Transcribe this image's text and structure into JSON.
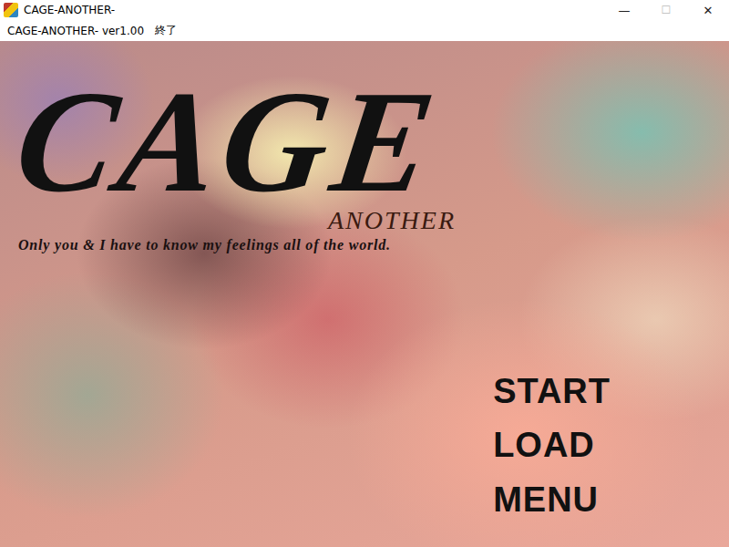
{
  "window": {
    "title": "CAGE-ANOTHER-",
    "controls": [
      "—",
      "☐",
      "✕"
    ]
  },
  "menu_bar": {
    "items": [
      "CAGE-ANOTHER- ver1.00",
      "終了"
    ]
  },
  "title_screen": {
    "logo": "CAGE",
    "subtitle": "ANOTHER",
    "tagline": "Only you & I have to know my feelings all of the world.",
    "menu": [
      {
        "label": "START",
        "selected": false
      },
      {
        "label": "LOAD",
        "selected": false
      },
      {
        "label": "MENU",
        "selected": false
      }
    ]
  }
}
